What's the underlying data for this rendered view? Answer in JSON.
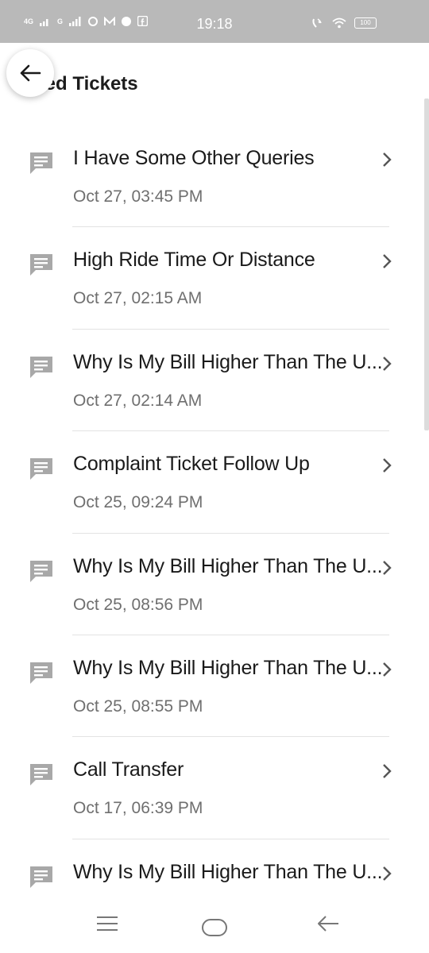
{
  "status_bar": {
    "time": "19:18",
    "battery": "100",
    "left_icons": [
      "4G",
      "G"
    ],
    "icons": [
      "signal-icon",
      "signal-icon",
      "app-icon",
      "mail-icon",
      "jio-icon",
      "facebook-icon",
      "wifi-call-icon",
      "wifi-icon",
      "battery-icon"
    ]
  },
  "header": {
    "title": "losed Tickets"
  },
  "tickets": [
    {
      "title": "I Have Some Other Queries",
      "date": "Oct 27, 03:45 PM"
    },
    {
      "title": "High Ride Time Or Distance",
      "date": "Oct 27, 02:15 AM"
    },
    {
      "title": "Why Is My Bill Higher Than The U...",
      "date": "Oct 27, 02:14 AM"
    },
    {
      "title": "Complaint Ticket Follow Up",
      "date": "Oct 25, 09:24 PM"
    },
    {
      "title": "Why Is My Bill Higher Than The U...",
      "date": "Oct 25, 08:56 PM"
    },
    {
      "title": "Why Is My Bill Higher Than The U...",
      "date": "Oct 25, 08:55 PM"
    },
    {
      "title": "Call Transfer",
      "date": "Oct 17, 06:39 PM"
    },
    {
      "title": "Why Is My Bill Higher Than The U...",
      "date": ""
    }
  ],
  "colors": {
    "status_bar_bg": "#b9b9b9",
    "text_primary": "#1a1a1a",
    "text_secondary": "#6f6f6f",
    "icon_gray": "#a8a8a8"
  }
}
